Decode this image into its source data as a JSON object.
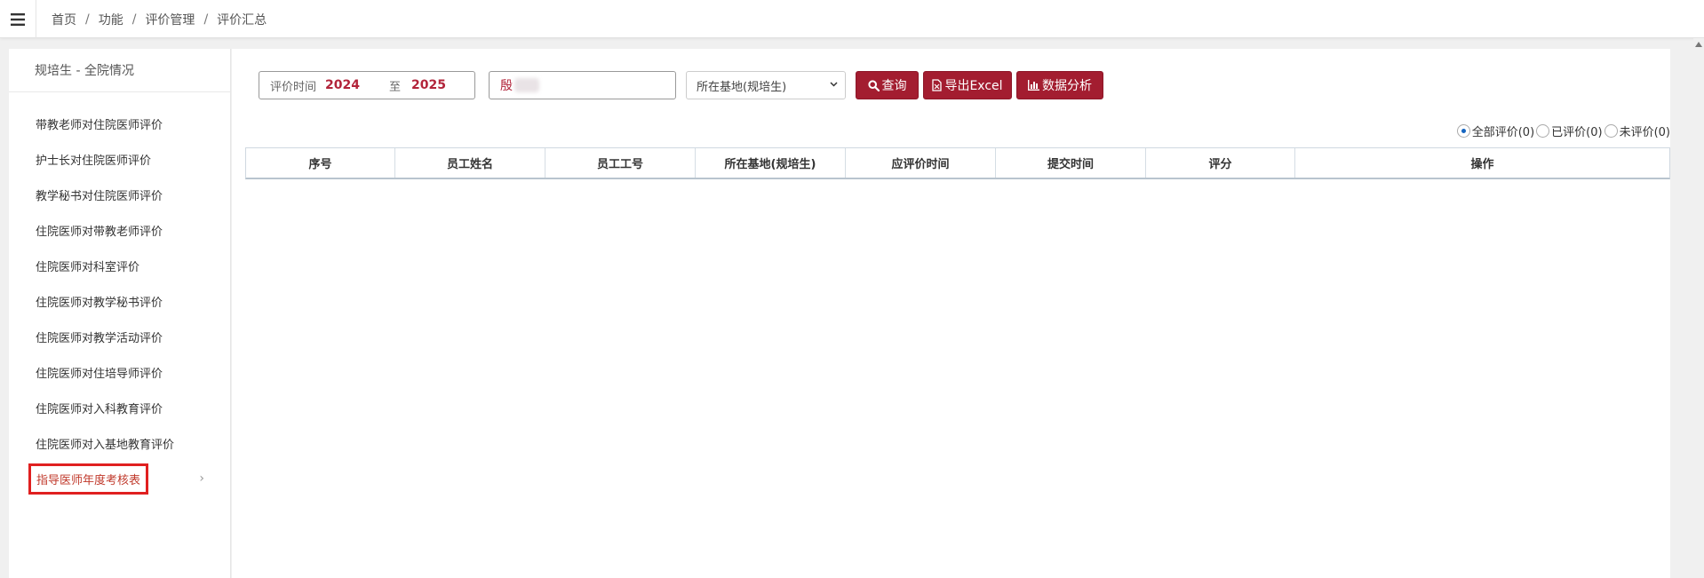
{
  "header": {
    "breadcrumb": [
      "首页",
      "功能",
      "评价管理",
      "评价汇总"
    ],
    "menu_icon": "hamburger-menu-icon"
  },
  "sidebar": {
    "title": "规培生 - 全院情况",
    "items": [
      {
        "label": "带教老师对住院医师评价"
      },
      {
        "label": "护士长对住院医师评价"
      },
      {
        "label": "教学秘书对住院医师评价"
      },
      {
        "label": "住院医师对带教老师评价"
      },
      {
        "label": "住院医师对科室评价"
      },
      {
        "label": "住院医师对教学秘书评价"
      },
      {
        "label": "住院医师对教学活动评价"
      },
      {
        "label": "住院医师对住培导师评价"
      },
      {
        "label": "住院医师对入科教育评价"
      },
      {
        "label": "住院医师对入基地教育评价"
      },
      {
        "label": "指导医师年度考核表",
        "active": true,
        "chevron": "›"
      }
    ]
  },
  "filters": {
    "date_label": "评价时间",
    "date_from": "2024",
    "date_sep": "至",
    "date_to": "2025",
    "name_value": "殷",
    "base_select": "所在基地(规培生)"
  },
  "buttons": {
    "query": "查询",
    "export": "导出Excel",
    "analysis": "数据分析"
  },
  "radios": [
    {
      "label": "全部评价(0)",
      "checked": true
    },
    {
      "label": "已评价(0)",
      "checked": false
    },
    {
      "label": "未评价(0)",
      "checked": false
    }
  ],
  "table": {
    "columns": [
      "序号",
      "员工姓名",
      "员工工号",
      "所在基地(规培生)",
      "应评价时间",
      "提交时间",
      "评分",
      "操作"
    ],
    "rows": []
  },
  "colors": {
    "accent": "#a31d30",
    "active_text": "#c0392b",
    "highlight_border": "#e02020"
  }
}
